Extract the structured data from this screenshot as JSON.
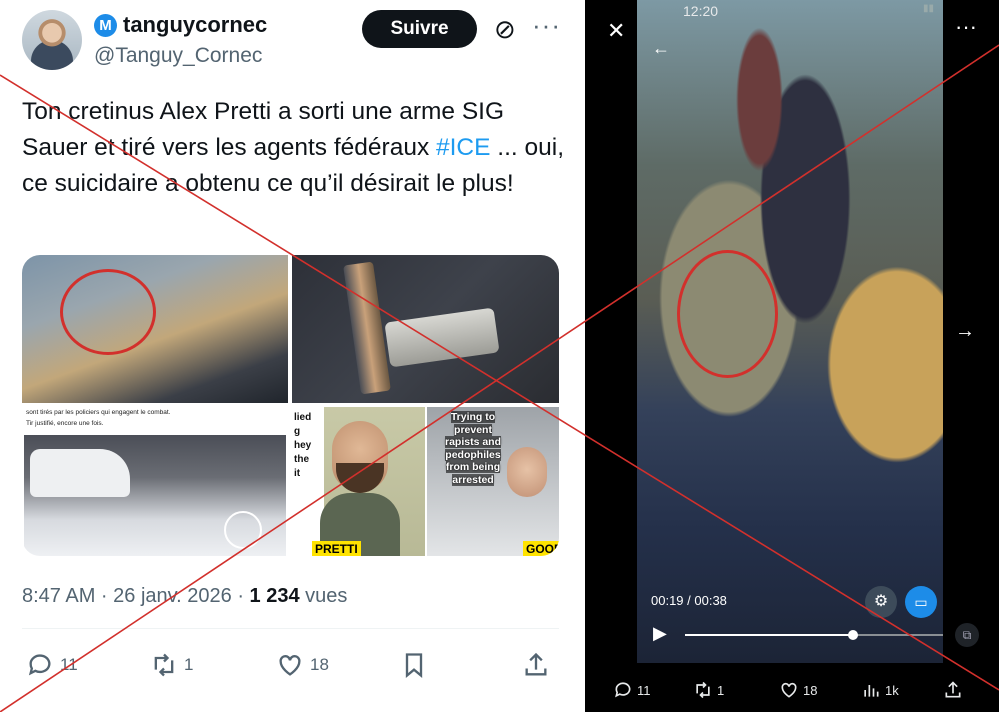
{
  "tweet": {
    "display_name": "tanguycornec",
    "badge_letter": "M",
    "handle": "@Tanguy_Cornec",
    "follow_label": "Suivre",
    "text_before": "Ton cretinus Alex Pretti a sorti une arme SIG Sauer et tiré vers les agents fédéraux ",
    "hashtag": "#ICE",
    "text_after": " ... oui, ce suicidaire a obtenu ce qu’il désirait le plus!",
    "media": {
      "caption_1": "sont tirés par les policiers qui engagent le combat.",
      "caption_2": "Tir justifié, encore une fois.",
      "fragment_lines": [
        "lied",
        "g",
        "hey",
        "the",
        "it"
      ],
      "label_pretti": "PRETTI",
      "overlay_text": "Trying to prevent rapists and pedophiles from being arrested",
      "label_good": "GOOD"
    },
    "time": "8:47 AM · 26 janv. 2026 · ",
    "views_count": "1 234",
    "views_label": " vues",
    "actions": {
      "replies": "11",
      "reposts": "1",
      "likes": "18"
    }
  },
  "video_view": {
    "status_time": "12:20",
    "timecode": "00:19 / 00:38",
    "progress": 0.65,
    "actions": {
      "replies": "11",
      "reposts": "1",
      "likes": "18",
      "views": "1k"
    }
  },
  "colors": {
    "accent": "#1d9bf0",
    "badge": "#1d8ce8",
    "cross": "#d2302c",
    "label_yellow": "#ffe300"
  }
}
